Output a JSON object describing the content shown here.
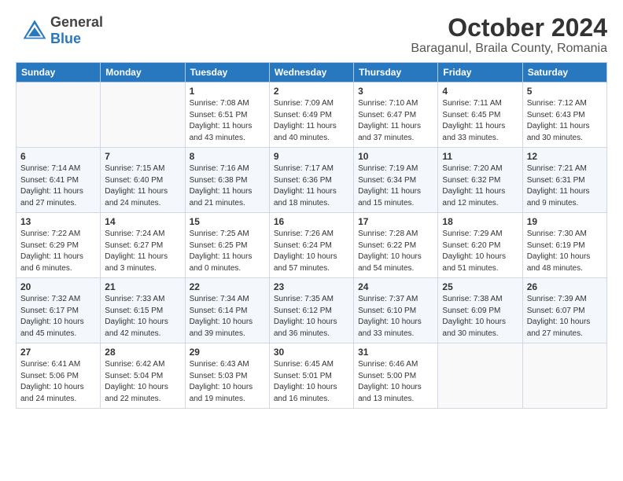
{
  "header": {
    "logo_general": "General",
    "logo_blue": "Blue",
    "month": "October 2024",
    "location": "Baraganul, Braila County, Romania"
  },
  "weekdays": [
    "Sunday",
    "Monday",
    "Tuesday",
    "Wednesday",
    "Thursday",
    "Friday",
    "Saturday"
  ],
  "weeks": [
    [
      {
        "day": "",
        "detail": ""
      },
      {
        "day": "",
        "detail": ""
      },
      {
        "day": "1",
        "detail": "Sunrise: 7:08 AM\nSunset: 6:51 PM\nDaylight: 11 hours and 43 minutes."
      },
      {
        "day": "2",
        "detail": "Sunrise: 7:09 AM\nSunset: 6:49 PM\nDaylight: 11 hours and 40 minutes."
      },
      {
        "day": "3",
        "detail": "Sunrise: 7:10 AM\nSunset: 6:47 PM\nDaylight: 11 hours and 37 minutes."
      },
      {
        "day": "4",
        "detail": "Sunrise: 7:11 AM\nSunset: 6:45 PM\nDaylight: 11 hours and 33 minutes."
      },
      {
        "day": "5",
        "detail": "Sunrise: 7:12 AM\nSunset: 6:43 PM\nDaylight: 11 hours and 30 minutes."
      }
    ],
    [
      {
        "day": "6",
        "detail": "Sunrise: 7:14 AM\nSunset: 6:41 PM\nDaylight: 11 hours and 27 minutes."
      },
      {
        "day": "7",
        "detail": "Sunrise: 7:15 AM\nSunset: 6:40 PM\nDaylight: 11 hours and 24 minutes."
      },
      {
        "day": "8",
        "detail": "Sunrise: 7:16 AM\nSunset: 6:38 PM\nDaylight: 11 hours and 21 minutes."
      },
      {
        "day": "9",
        "detail": "Sunrise: 7:17 AM\nSunset: 6:36 PM\nDaylight: 11 hours and 18 minutes."
      },
      {
        "day": "10",
        "detail": "Sunrise: 7:19 AM\nSunset: 6:34 PM\nDaylight: 11 hours and 15 minutes."
      },
      {
        "day": "11",
        "detail": "Sunrise: 7:20 AM\nSunset: 6:32 PM\nDaylight: 11 hours and 12 minutes."
      },
      {
        "day": "12",
        "detail": "Sunrise: 7:21 AM\nSunset: 6:31 PM\nDaylight: 11 hours and 9 minutes."
      }
    ],
    [
      {
        "day": "13",
        "detail": "Sunrise: 7:22 AM\nSunset: 6:29 PM\nDaylight: 11 hours and 6 minutes."
      },
      {
        "day": "14",
        "detail": "Sunrise: 7:24 AM\nSunset: 6:27 PM\nDaylight: 11 hours and 3 minutes."
      },
      {
        "day": "15",
        "detail": "Sunrise: 7:25 AM\nSunset: 6:25 PM\nDaylight: 11 hours and 0 minutes."
      },
      {
        "day": "16",
        "detail": "Sunrise: 7:26 AM\nSunset: 6:24 PM\nDaylight: 10 hours and 57 minutes."
      },
      {
        "day": "17",
        "detail": "Sunrise: 7:28 AM\nSunset: 6:22 PM\nDaylight: 10 hours and 54 minutes."
      },
      {
        "day": "18",
        "detail": "Sunrise: 7:29 AM\nSunset: 6:20 PM\nDaylight: 10 hours and 51 minutes."
      },
      {
        "day": "19",
        "detail": "Sunrise: 7:30 AM\nSunset: 6:19 PM\nDaylight: 10 hours and 48 minutes."
      }
    ],
    [
      {
        "day": "20",
        "detail": "Sunrise: 7:32 AM\nSunset: 6:17 PM\nDaylight: 10 hours and 45 minutes."
      },
      {
        "day": "21",
        "detail": "Sunrise: 7:33 AM\nSunset: 6:15 PM\nDaylight: 10 hours and 42 minutes."
      },
      {
        "day": "22",
        "detail": "Sunrise: 7:34 AM\nSunset: 6:14 PM\nDaylight: 10 hours and 39 minutes."
      },
      {
        "day": "23",
        "detail": "Sunrise: 7:35 AM\nSunset: 6:12 PM\nDaylight: 10 hours and 36 minutes."
      },
      {
        "day": "24",
        "detail": "Sunrise: 7:37 AM\nSunset: 6:10 PM\nDaylight: 10 hours and 33 minutes."
      },
      {
        "day": "25",
        "detail": "Sunrise: 7:38 AM\nSunset: 6:09 PM\nDaylight: 10 hours and 30 minutes."
      },
      {
        "day": "26",
        "detail": "Sunrise: 7:39 AM\nSunset: 6:07 PM\nDaylight: 10 hours and 27 minutes."
      }
    ],
    [
      {
        "day": "27",
        "detail": "Sunrise: 6:41 AM\nSunset: 5:06 PM\nDaylight: 10 hours and 24 minutes."
      },
      {
        "day": "28",
        "detail": "Sunrise: 6:42 AM\nSunset: 5:04 PM\nDaylight: 10 hours and 22 minutes."
      },
      {
        "day": "29",
        "detail": "Sunrise: 6:43 AM\nSunset: 5:03 PM\nDaylight: 10 hours and 19 minutes."
      },
      {
        "day": "30",
        "detail": "Sunrise: 6:45 AM\nSunset: 5:01 PM\nDaylight: 10 hours and 16 minutes."
      },
      {
        "day": "31",
        "detail": "Sunrise: 6:46 AM\nSunset: 5:00 PM\nDaylight: 10 hours and 13 minutes."
      },
      {
        "day": "",
        "detail": ""
      },
      {
        "day": "",
        "detail": ""
      }
    ]
  ]
}
